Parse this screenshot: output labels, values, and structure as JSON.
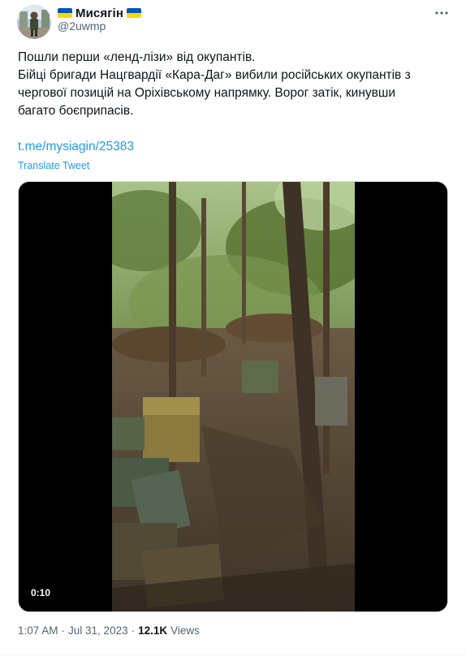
{
  "author": {
    "display_name": "Мисягін",
    "handle": "@2uwmp",
    "flag_colors": [
      "#0057b7",
      "#ffd700"
    ]
  },
  "tweet": {
    "lines": [
      "Пошли перши «ленд-лізи» від окупантів.",
      "Бійці бригади Нацгвардії «Кара-Даг» вибили російських окупантів з",
      "чергової позицій на Оріхівському напрямку. Ворог затік, кинувши",
      "багато боєприпасів."
    ],
    "link": "t.me/mysiagin/25383",
    "translate_label": "Translate Tweet"
  },
  "video": {
    "duration": "0:10"
  },
  "meta": {
    "time": "1:07 AM",
    "separator": "·",
    "date": "Jul 31, 2023",
    "views_count": "12.1K",
    "views_label": "Views"
  },
  "colors": {
    "link": "#1d9bf0",
    "secondary_text": "#536471",
    "primary_text": "#0f1419"
  },
  "icons": {
    "more": "more-horizontal-icon",
    "flag": "ukraine-flag-icon"
  }
}
